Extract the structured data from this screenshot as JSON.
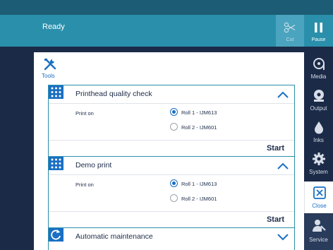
{
  "status": {
    "text": "Ready"
  },
  "toolbar": {
    "cut_label": "Cut",
    "pause_label": "Pause"
  },
  "tools": {
    "label": "Tools"
  },
  "cards": [
    {
      "title": "Printhead quality check",
      "print_on_label": "Print on",
      "options": [
        "Roll 1 - IJM613",
        "Roll 2 - IJM601"
      ],
      "selected": 0,
      "start_label": "Start",
      "expanded": true,
      "icon": "printhead-icon"
    },
    {
      "title": "Demo print",
      "print_on_label": "Print on",
      "options": [
        "Roll 1 - IJM613",
        "Roll 2 - IJM601"
      ],
      "selected": 0,
      "start_label": "Start",
      "expanded": true,
      "icon": "printhead-icon"
    },
    {
      "title": "Automatic maintenance",
      "expanded": false,
      "icon": "refresh-icon"
    }
  ],
  "nav": [
    {
      "label": "Media",
      "icon": "media-icon"
    },
    {
      "label": "Output",
      "icon": "output-icon"
    },
    {
      "label": "Inks",
      "icon": "ink-drop-icon"
    },
    {
      "label": "System",
      "icon": "gear-icon"
    },
    {
      "label": "Close",
      "icon": "close-icon"
    },
    {
      "label": "Service",
      "icon": "service-icon"
    }
  ],
  "colors": {
    "accent": "#1a6fc4",
    "teal": "#2a8fab",
    "dark": "#1b2a47"
  }
}
